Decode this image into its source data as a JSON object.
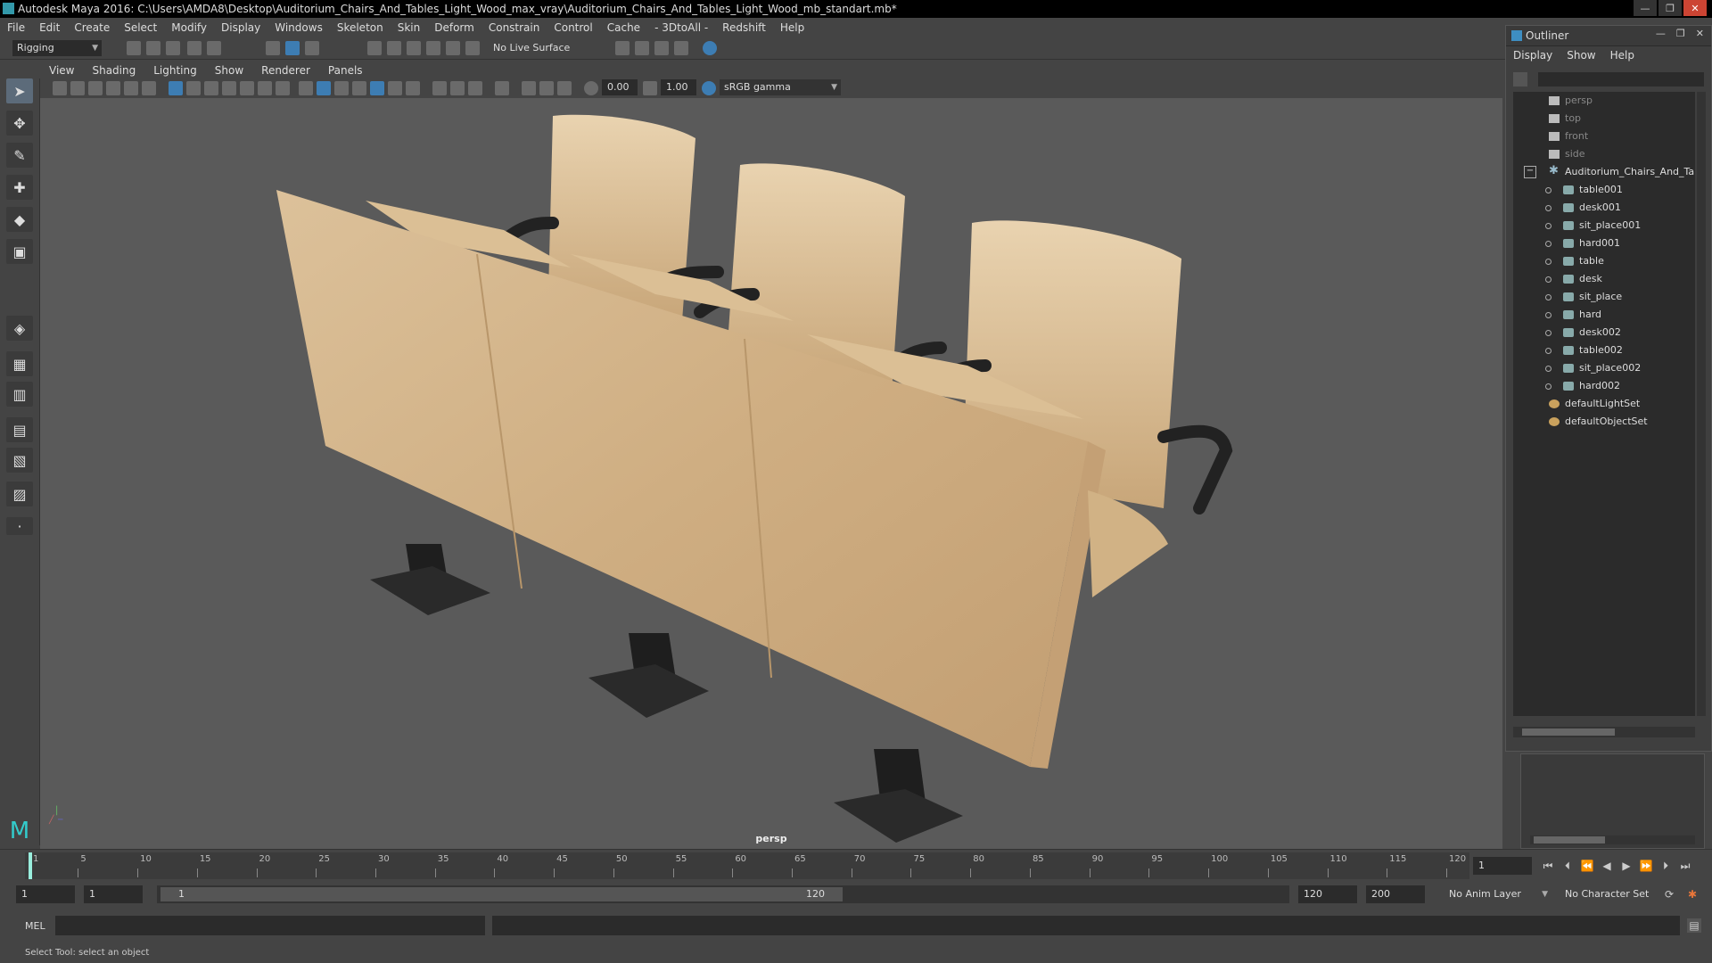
{
  "app": {
    "title": "Autodesk Maya 2016: C:\\Users\\AMDA8\\Desktop\\Auditorium_Chairs_And_Tables_Light_Wood_max_vray\\Auditorium_Chairs_And_Tables_Light_Wood_mb_standart.mb*"
  },
  "menu": [
    "File",
    "Edit",
    "Create",
    "Select",
    "Modify",
    "Display",
    "Windows",
    "Skeleton",
    "Skin",
    "Deform",
    "Constrain",
    "Control",
    "Cache",
    "- 3DtoAll -",
    "Redshift",
    "Help"
  ],
  "toolbar": {
    "mode": "Rigging",
    "live_surface": "No Live Surface"
  },
  "viewport_menu": [
    "View",
    "Shading",
    "Lighting",
    "Show",
    "Renderer",
    "Panels"
  ],
  "viewport_toolbar": {
    "value1": "0.00",
    "value2": "1.00",
    "color_space": "sRGB gamma"
  },
  "viewport": {
    "camera": "persp"
  },
  "outliner": {
    "title": "Outliner",
    "menu": [
      "Display",
      "Show",
      "Help"
    ],
    "items": [
      {
        "label": "persp",
        "type": "camera",
        "level": 1,
        "dim": true
      },
      {
        "label": "top",
        "type": "camera",
        "level": 1,
        "dim": true
      },
      {
        "label": "front",
        "type": "camera",
        "level": 1,
        "dim": true
      },
      {
        "label": "side",
        "type": "camera",
        "level": 1,
        "dim": true
      },
      {
        "label": "Auditorium_Chairs_And_Tal",
        "type": "group",
        "level": 1,
        "dim": false
      },
      {
        "label": "table001",
        "type": "mesh",
        "level": 2,
        "dim": false
      },
      {
        "label": "desk001",
        "type": "mesh",
        "level": 2,
        "dim": false
      },
      {
        "label": "sit_place001",
        "type": "mesh",
        "level": 2,
        "dim": false
      },
      {
        "label": "hard001",
        "type": "mesh",
        "level": 2,
        "dim": false
      },
      {
        "label": "table",
        "type": "mesh",
        "level": 2,
        "dim": false
      },
      {
        "label": "desk",
        "type": "mesh",
        "level": 2,
        "dim": false
      },
      {
        "label": "sit_place",
        "type": "mesh",
        "level": 2,
        "dim": false
      },
      {
        "label": "hard",
        "type": "mesh",
        "level": 2,
        "dim": false
      },
      {
        "label": "desk002",
        "type": "mesh",
        "level": 2,
        "dim": false
      },
      {
        "label": "table002",
        "type": "mesh",
        "level": 2,
        "dim": false
      },
      {
        "label": "sit_place002",
        "type": "mesh",
        "level": 2,
        "dim": false
      },
      {
        "label": "hard002",
        "type": "mesh",
        "level": 2,
        "dim": false
      },
      {
        "label": "defaultLightSet",
        "type": "set",
        "level": 1,
        "dim": false
      },
      {
        "label": "defaultObjectSet",
        "type": "set",
        "level": 1,
        "dim": false
      }
    ]
  },
  "timeline": {
    "ticks": [
      "1",
      "5",
      "10",
      "15",
      "20",
      "25",
      "30",
      "35",
      "40",
      "45",
      "50",
      "55",
      "60",
      "65",
      "70",
      "75",
      "80",
      "85",
      "90",
      "95",
      "100",
      "105",
      "110",
      "115",
      "120"
    ],
    "current_frame": "1"
  },
  "range": {
    "start": "1",
    "start2": "1",
    "slider_start": "1",
    "slider_end": "120",
    "end": "120",
    "end2": "200",
    "anim_layer": "No Anim Layer",
    "char_set": "No Character Set"
  },
  "cmd": {
    "lang": "MEL"
  },
  "help": {
    "text": "Select Tool: select an object"
  },
  "colors": {
    "wood": "#d8b98e",
    "metal": "#2a2a2a",
    "viewport_bg": "#5a5a5a",
    "accent": "#3d7db3"
  }
}
